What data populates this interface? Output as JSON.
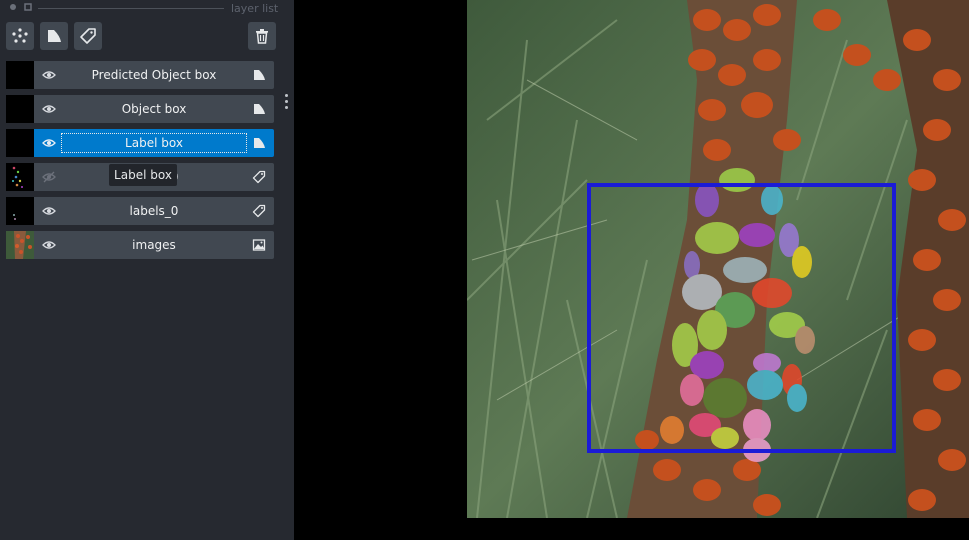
{
  "panel": {
    "title": "layer list"
  },
  "toolbar": {
    "buttons": [
      {
        "name": "new-points-layer-button",
        "icon": "points-icon"
      },
      {
        "name": "new-shapes-layer-button",
        "icon": "shapes-icon"
      },
      {
        "name": "new-labels-layer-button",
        "icon": "label-tag-icon"
      },
      {
        "name": "delete-layer-button",
        "icon": "trash-icon"
      }
    ]
  },
  "layers": [
    {
      "name": "Predicted Object box",
      "type": "shapes",
      "visible": true,
      "selected": false
    },
    {
      "name": "Object box",
      "type": "shapes",
      "visible": true,
      "selected": false
    },
    {
      "name": "Label box",
      "type": "shapes",
      "visible": true,
      "selected": true,
      "editing": true
    },
    {
      "name": "labels_0",
      "type": "labels",
      "visible": false,
      "selected": false
    },
    {
      "name": "labels_0",
      "type": "labels",
      "visible": true,
      "selected": false
    },
    {
      "name": "images",
      "type": "image",
      "visible": true,
      "selected": false
    }
  ],
  "tooltip": {
    "text": "Label box"
  },
  "colors": {
    "panel_bg": "#262930",
    "row_bg": "#414851",
    "selected_bg": "#007acc",
    "box_color": "#1b1bd6"
  }
}
